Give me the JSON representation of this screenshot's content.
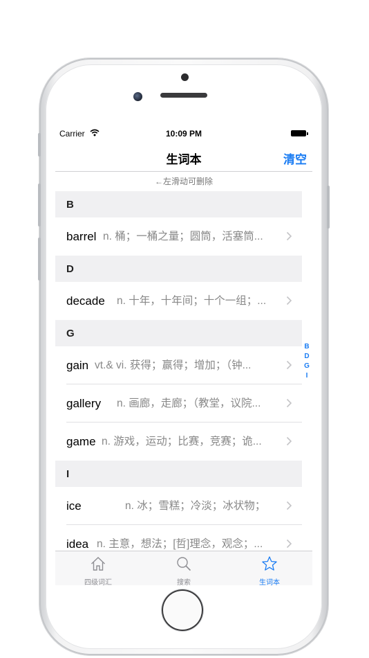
{
  "status_bar": {
    "carrier": "Carrier",
    "time": "10:09 PM"
  },
  "nav": {
    "title": "生词本",
    "clear_label": "清空"
  },
  "hint": "←左滑动可删除",
  "sections": [
    {
      "letter": "B",
      "rows": [
        {
          "word": "barrel",
          "definition": "n. 桶；一桶之量；圆筒，活塞筒..."
        }
      ]
    },
    {
      "letter": "D",
      "rows": [
        {
          "word": "decade",
          "definition": "n. 十年，十年间；十个一组；..."
        }
      ]
    },
    {
      "letter": "G",
      "rows": [
        {
          "word": "gain",
          "definition": "vt.& vi. 获得；赢得；增加；（钟..."
        },
        {
          "word": "gallery",
          "definition": "n. 画廊，走廊；（教堂，议院..."
        },
        {
          "word": "game",
          "definition": "n. 游戏，运动；比赛，竞赛；诡..."
        }
      ]
    },
    {
      "letter": "I",
      "rows": [
        {
          "word": "ice",
          "definition": "n. 冰；雪糕；冷淡；冰状物；"
        },
        {
          "word": "idea",
          "definition": "n. 主意，想法；[哲]理念，观念；..."
        }
      ]
    }
  ],
  "index": [
    "B",
    "D",
    "G",
    "I"
  ],
  "tabs": [
    {
      "label": "四级词汇",
      "icon": "house-icon"
    },
    {
      "label": "搜索",
      "icon": "search-icon"
    },
    {
      "label": "生词本",
      "icon": "star-icon",
      "active": true
    }
  ],
  "colors": {
    "accent": "#1a7cf3",
    "section_bg": "#f0f0f2",
    "definition_text": "#888888"
  }
}
